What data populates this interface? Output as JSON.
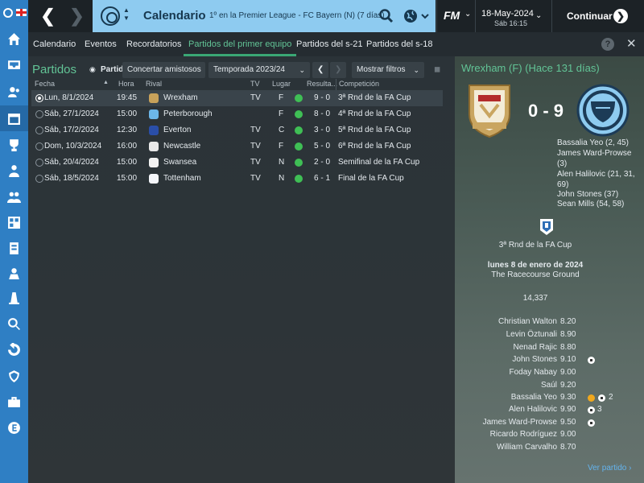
{
  "topbar": {
    "title": "Calendario",
    "subtitle": "1º en la Premier League - FC Bayern (N) (7 días)",
    "logo": "FM",
    "date": "18-May-2024",
    "date_sub": "Sáb 16:15",
    "continue_label": "Continuar",
    "accent": "#8ecbf0"
  },
  "tabs": [
    {
      "label": "Calendario"
    },
    {
      "label": "Eventos"
    },
    {
      "label": "Recordatorios"
    },
    {
      "label": "Partidos del primer equipo"
    },
    {
      "label": "Partidos del s-21"
    },
    {
      "label": "Partidos del s-18"
    }
  ],
  "main": {
    "section_title": "Partidos",
    "toggle_label": "Partid",
    "friendly_btn": "Concertar amistosos",
    "season": "Temporada 2023/24",
    "filters": "Mostrar filtros",
    "headers": {
      "date": "Fecha",
      "time": "Hora",
      "opponent": "Rival",
      "tv": "TV",
      "venue": "Lugar",
      "result": "Resulta...",
      "competition": "Competición"
    },
    "rows": [
      {
        "date": "Lun, 8/1/2024",
        "time": "19:45",
        "opponent": "Wrexham",
        "tv": "TV",
        "venue": "F",
        "result": "9 - 0",
        "competition": "3ª Rnd de la FA Cup",
        "crest_color": "#c8a25a"
      },
      {
        "date": "Sáb, 27/1/2024",
        "time": "15:00",
        "opponent": "Peterborough",
        "tv": "",
        "venue": "F",
        "result": "8 - 0",
        "competition": "4ª Rnd de la FA Cup",
        "crest_color": "#6cb6e8"
      },
      {
        "date": "Sáb, 17/2/2024",
        "time": "12:30",
        "opponent": "Everton",
        "tv": "TV",
        "venue": "C",
        "result": "3 - 0",
        "competition": "5ª Rnd de la FA Cup",
        "crest_color": "#2a4ea8"
      },
      {
        "date": "Dom, 10/3/2024",
        "time": "16:00",
        "opponent": "Newcastle",
        "tv": "TV",
        "venue": "F",
        "result": "5 - 0",
        "competition": "6ª Rnd de la FA Cup",
        "crest_color": "#e8e8e8"
      },
      {
        "date": "Sáb, 20/4/2024",
        "time": "15:00",
        "opponent": "Swansea",
        "tv": "TV",
        "venue": "N",
        "result": "2 - 0",
        "competition": "Semifinal de la FA Cup",
        "crest_color": "#f2f2f2"
      },
      {
        "date": "Sáb, 18/5/2024",
        "time": "15:00",
        "opponent": "Tottenham",
        "tv": "TV",
        "venue": "N",
        "result": "6 - 1",
        "competition": "Final de la FA Cup",
        "crest_color": "#f4f6fa"
      }
    ]
  },
  "match": {
    "header": "Wrexham (F) (Hace 131 días)",
    "score": "0 - 9",
    "scorers": [
      "Bassalia Yeo (2, 45)",
      "James Ward-Prowse",
      "(3)",
      "Alen Halilovic (21, 31,",
      "69)",
      "John Stones (37)",
      "Sean Mills (54, 58)"
    ],
    "competition": "3ª Rnd de la FA Cup",
    "date": "lunes 8 de enero de 2024",
    "stadium": "The Racecourse Ground",
    "attendance": "14,337",
    "players": [
      {
        "name": "Christian Walton",
        "rating": "8.20"
      },
      {
        "name": "Levin Öztunali",
        "rating": "8.90"
      },
      {
        "name": "Nenad Rajic",
        "rating": "8.80"
      },
      {
        "name": "John Stones",
        "rating": "9.10"
      },
      {
        "name": "Foday Nabay",
        "rating": "9.00"
      },
      {
        "name": "Saúl",
        "rating": "9.20"
      },
      {
        "name": "Bassalia Yeo",
        "rating": "9.30"
      },
      {
        "name": "Alen Halilovic",
        "rating": "9.90"
      },
      {
        "name": "James Ward-Prowse",
        "rating": "9.50"
      },
      {
        "name": "Ricardo Rodríguez",
        "rating": "9.00"
      },
      {
        "name": "William Carvalho",
        "rating": "8.70"
      }
    ],
    "goal_count_yeo": "2",
    "goal_count_halilovic": "3",
    "view_match": "Ver partido"
  }
}
